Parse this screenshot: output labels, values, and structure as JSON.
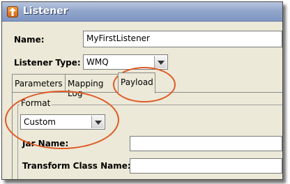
{
  "window": {
    "title": "Listener"
  },
  "form": {
    "name_label": "Name:",
    "name_value": "MyFirstListener",
    "type_label": "Listener Type:",
    "type_value": "WMQ"
  },
  "tabs": [
    {
      "label": "Parameters"
    },
    {
      "label": "Mapping Log"
    },
    {
      "label": "Payload"
    }
  ],
  "payload": {
    "format_legend": "Format",
    "format_value": "Custom",
    "jar_label": "Jar Name:",
    "jar_value": "",
    "transform_label": "Transform Class Name:",
    "transform_value": ""
  },
  "colors": {
    "highlight": "#e05a26"
  }
}
